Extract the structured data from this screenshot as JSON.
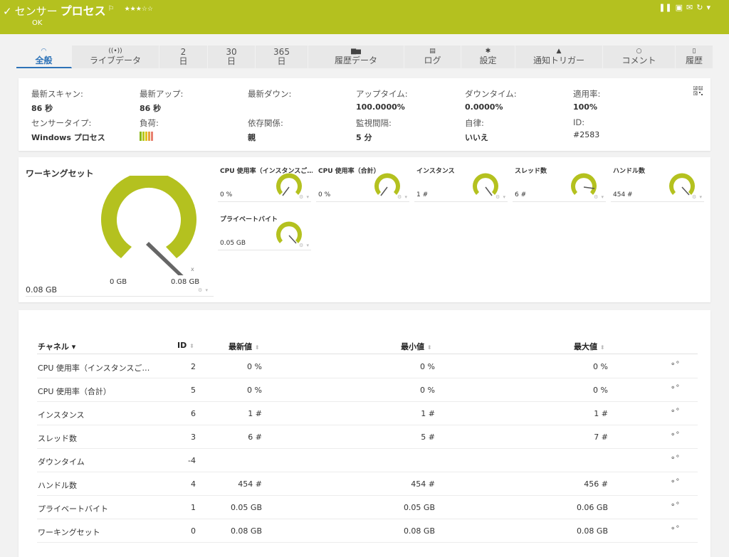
{
  "header": {
    "check": "✓",
    "title_prefix": "センサー",
    "title_name": "プロセス",
    "flag": "⚐",
    "stars": "★★★☆☆",
    "status": "OK",
    "accent": "#b4c11f"
  },
  "tabs": [
    {
      "icon": "◠",
      "label": "全般"
    },
    {
      "icon": "((•))",
      "label": "ライブデータ"
    },
    {
      "icon": "2",
      "label": "日"
    },
    {
      "icon": "30",
      "label": "日"
    },
    {
      "icon": "365",
      "label": "日"
    },
    {
      "icon": "▆▅",
      "label": "履歴データ"
    },
    {
      "icon": "▤",
      "label": "ログ"
    },
    {
      "icon": "✱",
      "label": "設定"
    },
    {
      "icon": "▲",
      "label": "通知トリガー"
    },
    {
      "icon": "○",
      "label": "コメント"
    },
    {
      "icon": "▯",
      "label": "履歴"
    }
  ],
  "info": {
    "last_scan": {
      "label": "最新スキャン:",
      "value": "86 秒"
    },
    "last_up": {
      "label": "最新アップ:",
      "value": "86 秒"
    },
    "last_down": {
      "label": "最新ダウン:",
      "value": ""
    },
    "uptime": {
      "label": "アップタイム:",
      "value": "100.0000%"
    },
    "downtime": {
      "label": "ダウンタイム:",
      "value": "0.0000%"
    },
    "coverage": {
      "label": "適用率:",
      "value": "100%"
    },
    "sensor_type": {
      "label": "センサータイプ:",
      "value": "Windows プロセス"
    },
    "load": {
      "label": "負荷:"
    },
    "dependency": {
      "label": "依存関係:",
      "value": "親"
    },
    "interval": {
      "label": "監視間隔:",
      "value": "5 分"
    },
    "autonomous": {
      "label": "自律:",
      "value": "いいえ"
    },
    "id": {
      "label": "ID:",
      "value": "#2583"
    }
  },
  "gauges": {
    "main": {
      "title": "ワーキングセット",
      "value": "0.08 GB",
      "min": "0 GB",
      "max": "0.08 GB"
    },
    "minis": [
      {
        "title": "CPU 使用率（インスタンスご…",
        "value": "0 %"
      },
      {
        "title": "CPU 使用率（合計）",
        "value": "0 %"
      },
      {
        "title": "インスタンス",
        "value": "1 #"
      },
      {
        "title": "スレッド数",
        "value": "6 #"
      },
      {
        "title": "ハンドル数",
        "value": "454 #"
      },
      {
        "title": "プライベートバイト",
        "value": "0.05 GB"
      }
    ]
  },
  "table": {
    "headers": {
      "channel": "チャネル ▾",
      "id": "ID",
      "last": "最新値",
      "min": "最小値",
      "max": "最大値"
    },
    "rows": [
      {
        "name": "CPU 使用率（インスタンスご…",
        "id": "2",
        "last": "0 %",
        "min": "0 %",
        "max": "0 %"
      },
      {
        "name": "CPU 使用率（合計）",
        "id": "5",
        "last": "0 %",
        "min": "0 %",
        "max": "0 %"
      },
      {
        "name": "インスタンス",
        "id": "6",
        "last": "1 #",
        "min": "1 #",
        "max": "1 #"
      },
      {
        "name": "スレッド数",
        "id": "3",
        "last": "6 #",
        "min": "5 #",
        "max": "7 #"
      },
      {
        "name": "ダウンタイム",
        "id": "-4",
        "last": "",
        "min": "",
        "max": ""
      },
      {
        "name": "ハンドル数",
        "id": "4",
        "last": "454 #",
        "min": "454 #",
        "max": "456 #"
      },
      {
        "name": "プライベートバイト",
        "id": "1",
        "last": "0.05 GB",
        "min": "0.05 GB",
        "max": "0.06 GB"
      },
      {
        "name": "ワーキングセット",
        "id": "0",
        "last": "0.08 GB",
        "min": "0.08 GB",
        "max": "0.08 GB"
      }
    ]
  }
}
